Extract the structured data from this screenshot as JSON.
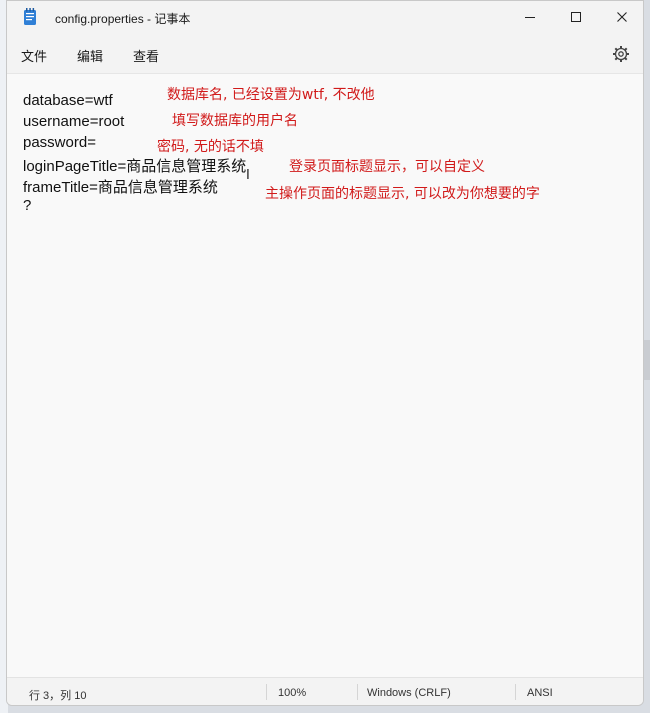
{
  "window": {
    "title": "config.properties - 记事本"
  },
  "menu": {
    "file": "文件",
    "edit": "编辑",
    "view": "查看"
  },
  "editor": {
    "lines": [
      "database=wtf",
      "username=root",
      "password=",
      "loginPageTitle=商品信息管理系统",
      "frameTitle=商品信息管理系统",
      "?"
    ],
    "annotations": [
      "数据库名, 已经设置为wtf, 不改他",
      "填写数据库的用户名",
      "密码, 无的话不填",
      "登录页面标题显示，可以自定义",
      "主操作页面的标题显示, 可以改为你想要的字"
    ]
  },
  "status": {
    "position": "行 3，列 10",
    "zoom": "100%",
    "line_ending": "Windows (CRLF)",
    "encoding": "ANSI"
  },
  "colors": {
    "annotation": "#d11a1a",
    "background": "#f9f9f9"
  }
}
